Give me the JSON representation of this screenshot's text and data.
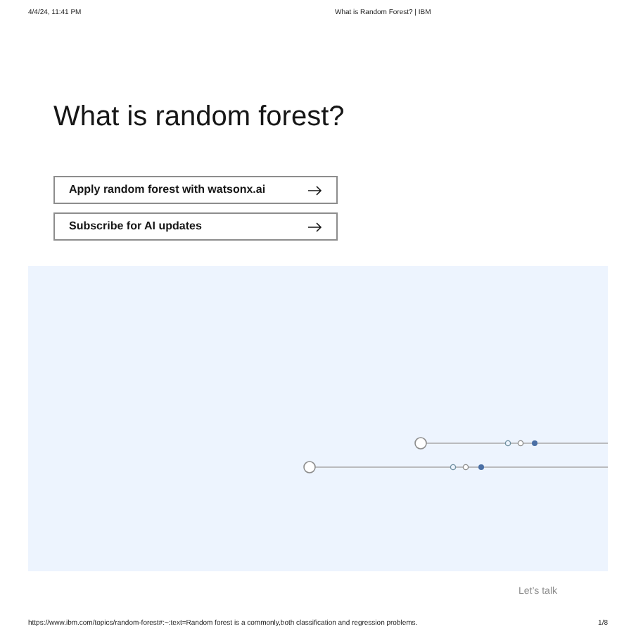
{
  "print_header": {
    "date": "4/4/24, 11:41 PM",
    "title": "What is Random Forest? | IBM"
  },
  "heading": "What is random forest?",
  "buttons": [
    {
      "label": "Apply random forest with watsonx.ai"
    },
    {
      "label": "Subscribe for AI updates"
    }
  ],
  "contact_link": "Let’s talk",
  "print_footer": {
    "url": "https://www.ibm.com/topics/random-forest#:~:text=Random forest is a commonly,both classification and regression problems.",
    "page": "1/8"
  }
}
